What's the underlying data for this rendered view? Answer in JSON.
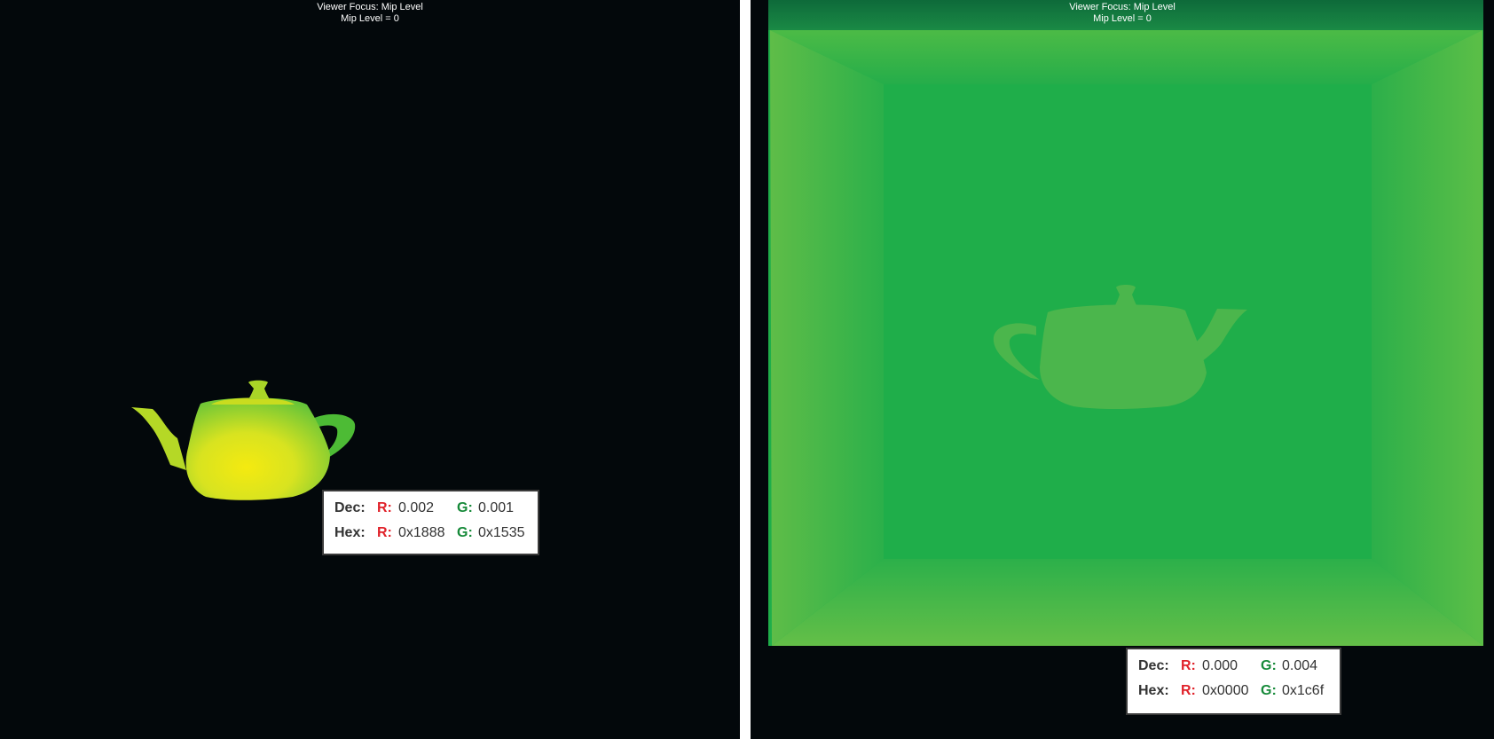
{
  "left_viewer": {
    "focus_label": "Viewer Focus: Mip Level",
    "mip_label": "Mip Level = 0",
    "readout": {
      "dec_label": "Dec:",
      "hex_label": "Hex:",
      "r_key": "R:",
      "g_key": "G:",
      "dec_r": "0.002",
      "dec_g": "0.001",
      "hex_r": "0x1888",
      "hex_g": "0x1535"
    }
  },
  "right_viewer": {
    "focus_label": "Viewer Focus: Mip Level",
    "mip_label": "Mip Level = 0",
    "readout": {
      "dec_label": "Dec:",
      "hex_label": "Hex:",
      "r_key": "R:",
      "g_key": "G:",
      "dec_r": "0.000",
      "dec_g": "0.004",
      "hex_r": "0x0000",
      "hex_g": "0x1c6f"
    }
  },
  "colors": {
    "viewport_bg": "#03080b",
    "divider": "#ffffff",
    "r_channel": "#e0222a",
    "g_channel": "#178a3a",
    "teapot_center": "#f4ea10",
    "teapot_edge": "#5fc23a",
    "room_green": "#1fae4a"
  },
  "icons": {
    "teapot_left": "teapot-render",
    "teapot_right": "teapot-silhouette"
  }
}
